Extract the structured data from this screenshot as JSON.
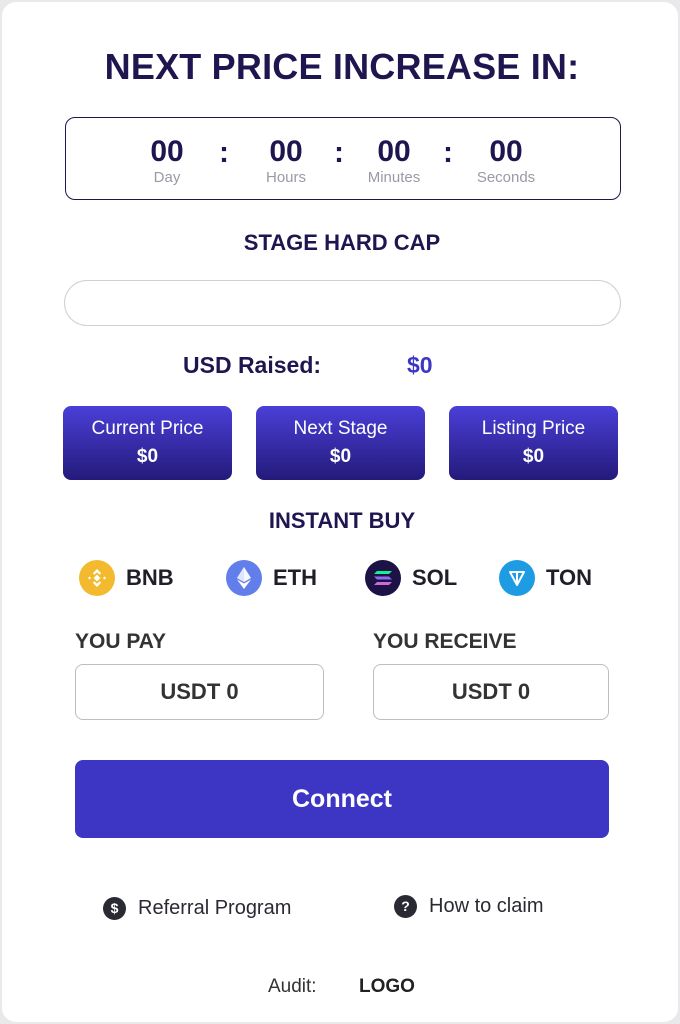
{
  "header": {
    "title": "NEXT PRICE INCREASE IN:"
  },
  "countdown": {
    "days": {
      "value": "00",
      "label": "Day"
    },
    "hours": {
      "value": "00",
      "label": "Hours"
    },
    "minutes": {
      "value": "00",
      "label": "Minutes"
    },
    "seconds": {
      "value": "00",
      "label": "Seconds"
    },
    "separator": ":"
  },
  "hard_cap": {
    "title": "STAGE HARD CAP",
    "progress_percent": 0
  },
  "raised": {
    "label": "USD Raised:",
    "value": "$0"
  },
  "prices": [
    {
      "label": "Current Price",
      "value": "$0"
    },
    {
      "label": "Next Stage",
      "value": "$0"
    },
    {
      "label": "Listing Price",
      "value": "$0"
    }
  ],
  "instant_buy": {
    "title": "INSTANT BUY",
    "coins": [
      {
        "name": "BNB",
        "icon": "bnb-icon",
        "color": "#f3ba2f"
      },
      {
        "name": "ETH",
        "icon": "eth-icon",
        "color": "#627eea"
      },
      {
        "name": "SOL",
        "icon": "sol-icon",
        "color": "#1c1245"
      },
      {
        "name": "TON",
        "icon": "ton-icon",
        "color": "#1e9ce3"
      }
    ]
  },
  "pay": {
    "label": "YOU PAY",
    "value": "USDT 0"
  },
  "receive": {
    "label": "YOU RECEIVE",
    "value": "USDT 0"
  },
  "connect": {
    "label": "Connect",
    "color": "#3d35c4"
  },
  "links": {
    "referral": {
      "label": "Referral Program",
      "icon": "dollar-icon",
      "glyph": "$"
    },
    "claim": {
      "label": "How to claim",
      "icon": "question-icon",
      "glyph": "?"
    }
  },
  "audit": {
    "label": "Audit:",
    "logo": "LOGO"
  }
}
